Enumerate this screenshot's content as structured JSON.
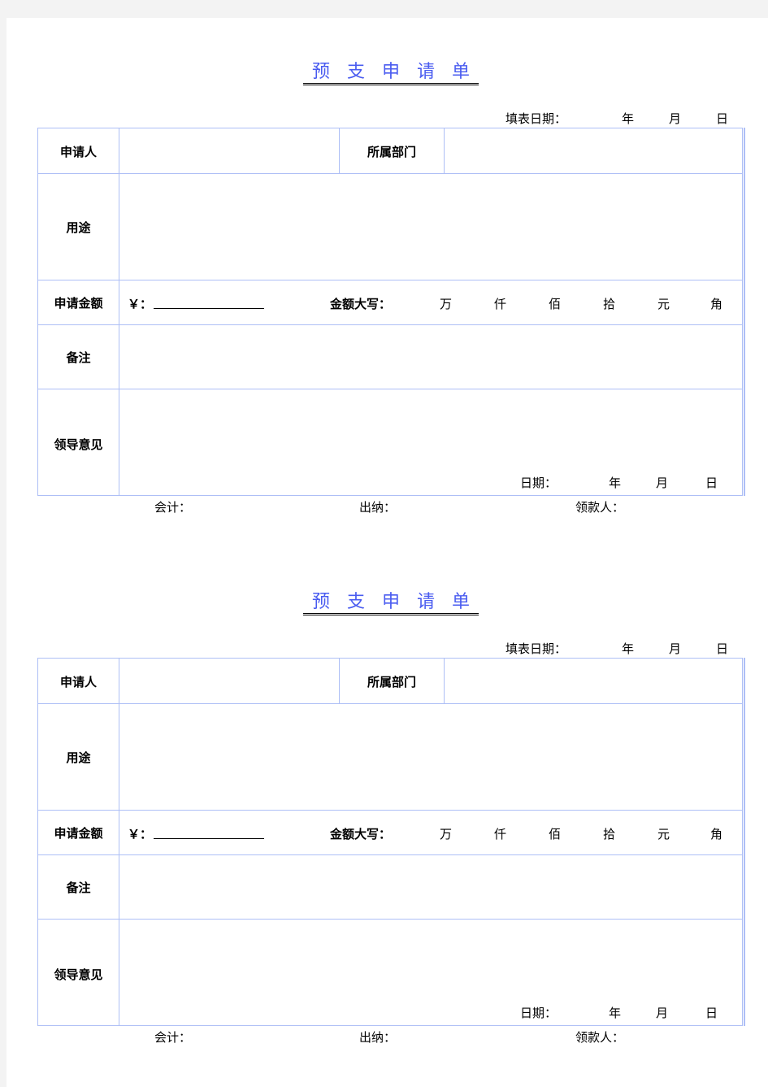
{
  "forms": [
    {
      "title_chars": [
        "预",
        "支",
        "申",
        "请",
        "单"
      ],
      "fill_date_label": "填表日期：",
      "year": "年",
      "month": "月",
      "day": "日",
      "applicant_label": "申请人",
      "applicant_value": "",
      "department_label": "所属部门",
      "department_value": "",
      "purpose_label": "用途",
      "purpose_value": "",
      "amount_label": "申请金额",
      "currency_prefix": "￥：",
      "amount_upper_label": "金额大写：",
      "amount_units": [
        "万",
        "仟",
        "佰",
        "拾",
        "元",
        "角"
      ],
      "remarks_label": "备注",
      "remarks_value": "",
      "leader_opinion_label": "领导意见",
      "leader_date_label": "日期：",
      "accountant_label": "会计：",
      "cashier_label": "出纳：",
      "recipient_label": "领款人："
    },
    {
      "title_chars": [
        "预",
        "支",
        "申",
        "请",
        "单"
      ],
      "fill_date_label": "填表日期：",
      "year": "年",
      "month": "月",
      "day": "日",
      "applicant_label": "申请人",
      "applicant_value": "",
      "department_label": "所属部门",
      "department_value": "",
      "purpose_label": "用途",
      "purpose_value": "",
      "amount_label": "申请金额",
      "currency_prefix": "￥：",
      "amount_upper_label": "金额大写：",
      "amount_units": [
        "万",
        "仟",
        "佰",
        "拾",
        "元",
        "角"
      ],
      "remarks_label": "备注",
      "remarks_value": "",
      "leader_opinion_label": "领导意见",
      "leader_date_label": "日期：",
      "accountant_label": "会计：",
      "cashier_label": "出纳：",
      "recipient_label": "领款人："
    }
  ]
}
